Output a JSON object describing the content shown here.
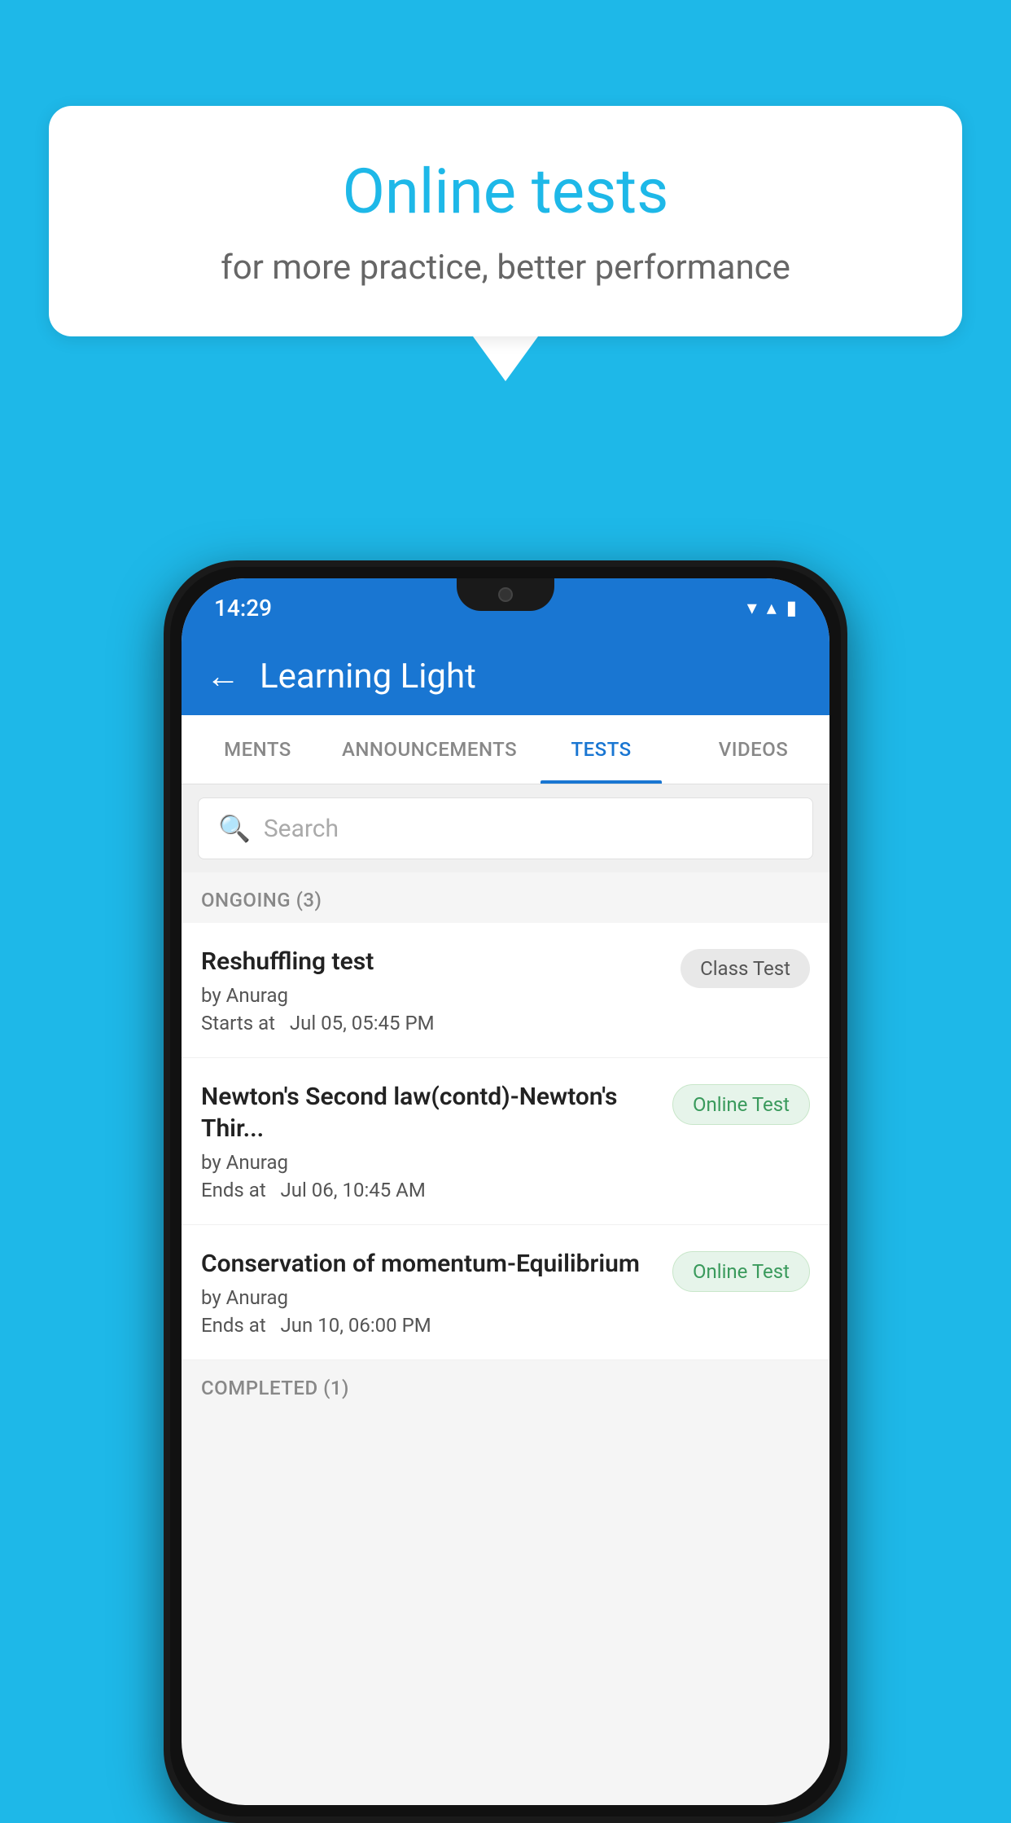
{
  "background_color": "#1eb8e8",
  "speech_bubble": {
    "title": "Online tests",
    "subtitle": "for more practice, better performance"
  },
  "status_bar": {
    "time": "14:29",
    "wifi_icon": "▼",
    "signal_icon": "▲",
    "battery_icon": "▮"
  },
  "app_bar": {
    "title": "Learning Light",
    "back_icon": "←"
  },
  "tabs": [
    {
      "label": "MENTS",
      "active": false
    },
    {
      "label": "ANNOUNCEMENTS",
      "active": false
    },
    {
      "label": "TESTS",
      "active": true
    },
    {
      "label": "VIDEOS",
      "active": false
    }
  ],
  "search": {
    "placeholder": "Search",
    "icon": "🔍"
  },
  "ongoing_section": {
    "label": "ONGOING (3)"
  },
  "tests": [
    {
      "title": "Reshuffling test",
      "author": "by Anurag",
      "time_label": "Starts at",
      "time": "Jul 05, 05:45 PM",
      "badge": "Class Test",
      "badge_type": "class"
    },
    {
      "title": "Newton's Second law(contd)-Newton's Thir...",
      "author": "by Anurag",
      "time_label": "Ends at",
      "time": "Jul 06, 10:45 AM",
      "badge": "Online Test",
      "badge_type": "online"
    },
    {
      "title": "Conservation of momentum-Equilibrium",
      "author": "by Anurag",
      "time_label": "Ends at",
      "time": "Jun 10, 06:00 PM",
      "badge": "Online Test",
      "badge_type": "online"
    }
  ],
  "completed_section": {
    "label": "COMPLETED (1)"
  }
}
